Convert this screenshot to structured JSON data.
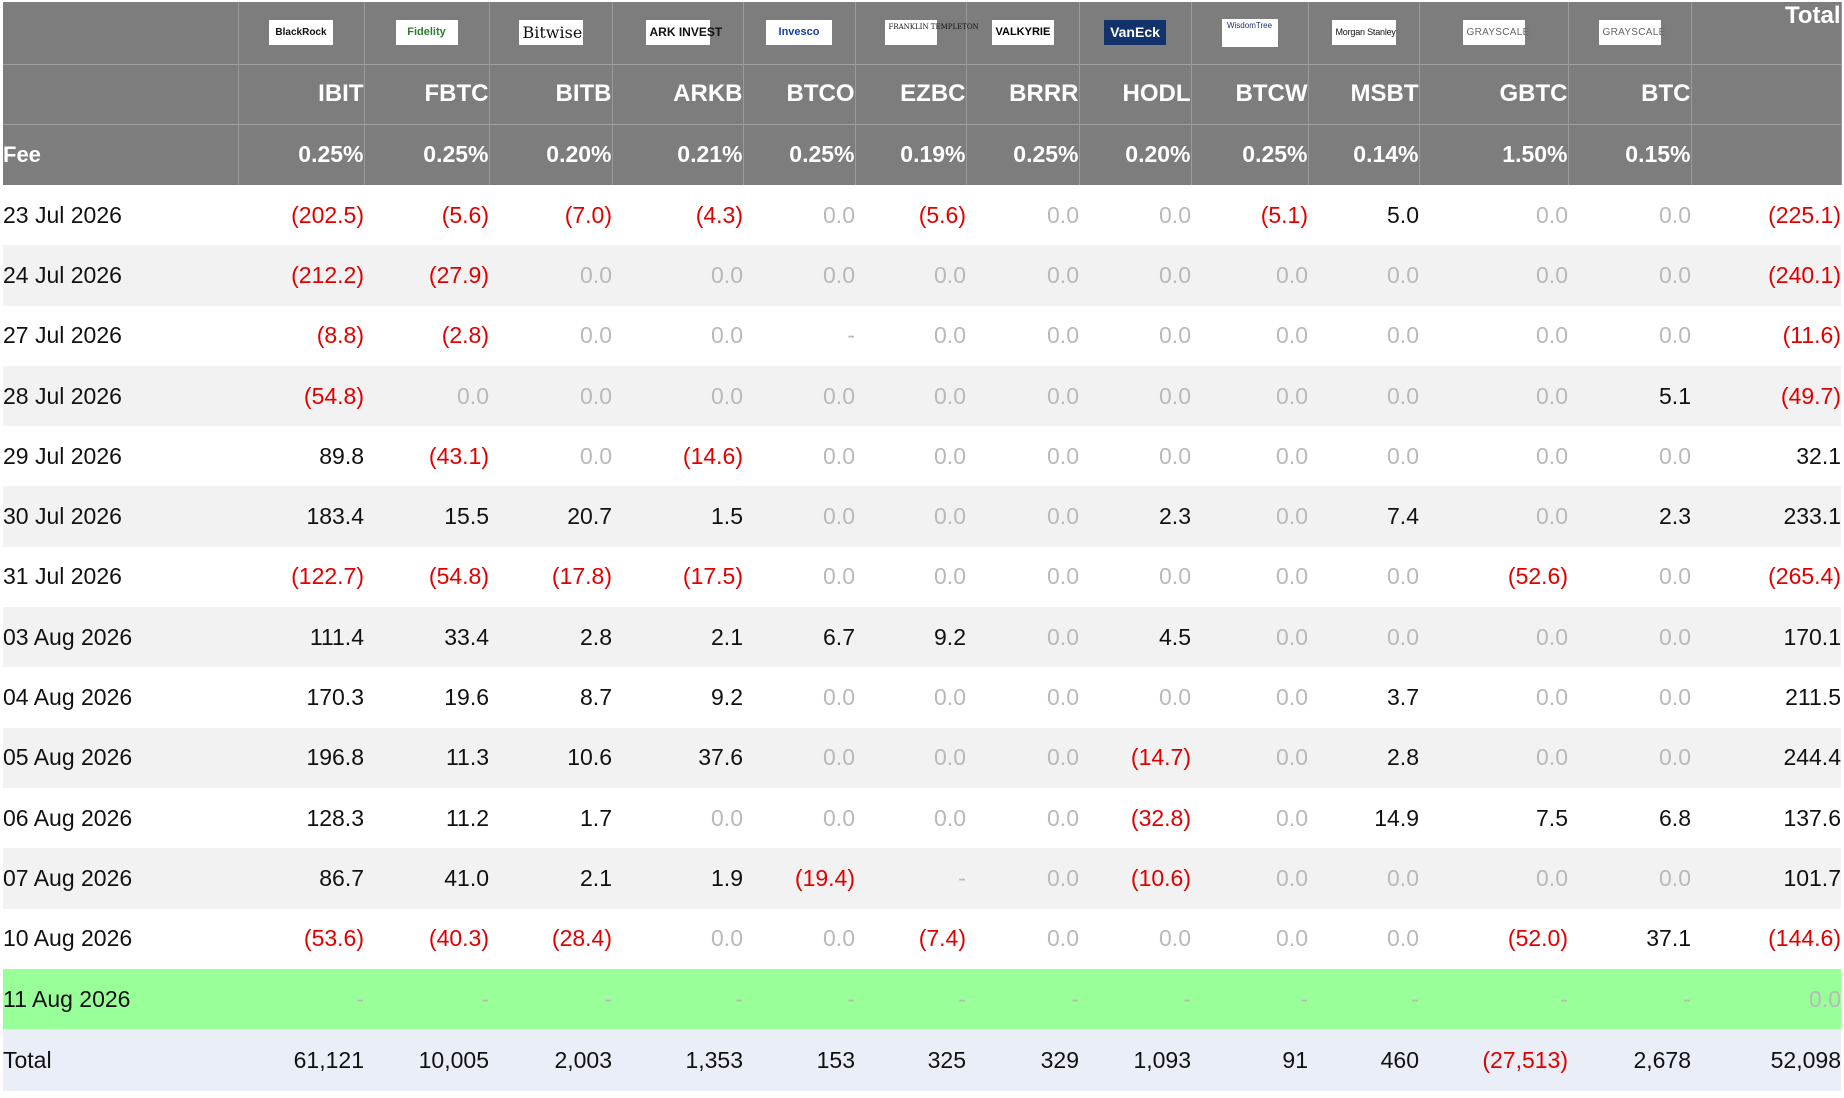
{
  "funds": [
    {
      "logo_text": "BlackRock",
      "logo_icon": "blackrock-logo",
      "ticker": "IBIT",
      "fee": "0.25%"
    },
    {
      "logo_text": "Fidelity",
      "logo_icon": "fidelity-logo",
      "ticker": "FBTC",
      "fee": "0.25%"
    },
    {
      "logo_text": "Bitwise",
      "logo_icon": "bitwise-logo",
      "ticker": "BITB",
      "fee": "0.20%"
    },
    {
      "logo_text": "ARK INVEST",
      "logo_icon": "ark-invest-logo",
      "ticker": "ARKB",
      "fee": "0.21%"
    },
    {
      "logo_text": "Invesco",
      "logo_icon": "invesco-logo",
      "ticker": "BTCO",
      "fee": "0.25%"
    },
    {
      "logo_text": "FRANKLIN TEMPLETON",
      "logo_icon": "franklin-templeton-logo",
      "ticker": "EZBC",
      "fee": "0.19%"
    },
    {
      "logo_text": "VALKYRIE",
      "logo_icon": "valkyrie-logo",
      "ticker": "BRRR",
      "fee": "0.25%"
    },
    {
      "logo_text": "VanEck",
      "logo_icon": "vaneck-logo",
      "ticker": "HODL",
      "fee": "0.20%"
    },
    {
      "logo_text": "WisdomTree",
      "logo_icon": "wisdomtree-logo",
      "ticker": "BTCW",
      "fee": "0.25%"
    },
    {
      "logo_text": "Morgan Stanley",
      "logo_icon": "morgan-stanley-logo",
      "ticker": "MSBT",
      "fee": "0.14%"
    },
    {
      "logo_text": "GRAYSCALE",
      "logo_icon": "grayscale-logo",
      "ticker": "GBTC",
      "fee": "1.50%"
    },
    {
      "logo_text": "GRAYSCALE",
      "logo_icon": "grayscale-logo",
      "ticker": "BTC",
      "fee": "0.15%"
    }
  ],
  "header": {
    "total_label": "Total",
    "fee_label": "Fee"
  },
  "rows": [
    {
      "date": "23 Jul 2026",
      "values": [
        "(202.5)",
        "(5.6)",
        "(7.0)",
        "(4.3)",
        "0.0",
        "(5.6)",
        "0.0",
        "0.0",
        "(5.1)",
        "5.0",
        "0.0",
        "0.0"
      ],
      "total": "(225.1)"
    },
    {
      "date": "24 Jul 2026",
      "values": [
        "(212.2)",
        "(27.9)",
        "0.0",
        "0.0",
        "0.0",
        "0.0",
        "0.0",
        "0.0",
        "0.0",
        "0.0",
        "0.0",
        "0.0"
      ],
      "total": "(240.1)"
    },
    {
      "date": "27 Jul 2026",
      "values": [
        "(8.8)",
        "(2.8)",
        "0.0",
        "0.0",
        "-",
        "0.0",
        "0.0",
        "0.0",
        "0.0",
        "0.0",
        "0.0",
        "0.0"
      ],
      "total": "(11.6)"
    },
    {
      "date": "28 Jul 2026",
      "values": [
        "(54.8)",
        "0.0",
        "0.0",
        "0.0",
        "0.0",
        "0.0",
        "0.0",
        "0.0",
        "0.0",
        "0.0",
        "0.0",
        "5.1"
      ],
      "total": "(49.7)"
    },
    {
      "date": "29 Jul 2026",
      "values": [
        "89.8",
        "(43.1)",
        "0.0",
        "(14.6)",
        "0.0",
        "0.0",
        "0.0",
        "0.0",
        "0.0",
        "0.0",
        "0.0",
        "0.0"
      ],
      "total": "32.1"
    },
    {
      "date": "30 Jul 2026",
      "values": [
        "183.4",
        "15.5",
        "20.7",
        "1.5",
        "0.0",
        "0.0",
        "0.0",
        "2.3",
        "0.0",
        "7.4",
        "0.0",
        "2.3"
      ],
      "total": "233.1"
    },
    {
      "date": "31 Jul 2026",
      "values": [
        "(122.7)",
        "(54.8)",
        "(17.8)",
        "(17.5)",
        "0.0",
        "0.0",
        "0.0",
        "0.0",
        "0.0",
        "0.0",
        "(52.6)",
        "0.0"
      ],
      "total": "(265.4)"
    },
    {
      "date": "03 Aug 2026",
      "values": [
        "111.4",
        "33.4",
        "2.8",
        "2.1",
        "6.7",
        "9.2",
        "0.0",
        "4.5",
        "0.0",
        "0.0",
        "0.0",
        "0.0"
      ],
      "total": "170.1"
    },
    {
      "date": "04 Aug 2026",
      "values": [
        "170.3",
        "19.6",
        "8.7",
        "9.2",
        "0.0",
        "0.0",
        "0.0",
        "0.0",
        "0.0",
        "3.7",
        "0.0",
        "0.0"
      ],
      "total": "211.5"
    },
    {
      "date": "05 Aug 2026",
      "values": [
        "196.8",
        "11.3",
        "10.6",
        "37.6",
        "0.0",
        "0.0",
        "0.0",
        "(14.7)",
        "0.0",
        "2.8",
        "0.0",
        "0.0"
      ],
      "total": "244.4"
    },
    {
      "date": "06 Aug 2026",
      "values": [
        "128.3",
        "11.2",
        "1.7",
        "0.0",
        "0.0",
        "0.0",
        "0.0",
        "(32.8)",
        "0.0",
        "14.9",
        "7.5",
        "6.8"
      ],
      "total": "137.6"
    },
    {
      "date": "07 Aug 2026",
      "values": [
        "86.7",
        "41.0",
        "2.1",
        "1.9",
        "(19.4)",
        "-",
        "0.0",
        "(10.6)",
        "0.0",
        "0.0",
        "0.0",
        "0.0"
      ],
      "total": "101.7"
    },
    {
      "date": "10 Aug 2026",
      "values": [
        "(53.6)",
        "(40.3)",
        "(28.4)",
        "0.0",
        "0.0",
        "(7.4)",
        "0.0",
        "0.0",
        "0.0",
        "0.0",
        "(52.0)",
        "37.1"
      ],
      "total": "(144.6)"
    },
    {
      "date": "11 Aug 2026",
      "values": [
        "-",
        "-",
        "-",
        "-",
        "-",
        "-",
        "-",
        "-",
        "-",
        "-",
        "-",
        "-"
      ],
      "total": "0.0",
      "highlight": true
    }
  ],
  "totals": {
    "label": "Total",
    "values": [
      "61,121",
      "10,005",
      "2,003",
      "1,353",
      "153",
      "325",
      "329",
      "1,093",
      "91",
      "460",
      "(27,513)",
      "2,678"
    ],
    "total": "52,098"
  },
  "colors": {
    "header_bg": "#7d7d7d",
    "negative": "#e00000",
    "zero": "#b9b9b9",
    "highlight_row": "#99ff99",
    "total_row": "#e9eef7",
    "stripe": "#f2f2f2"
  }
}
